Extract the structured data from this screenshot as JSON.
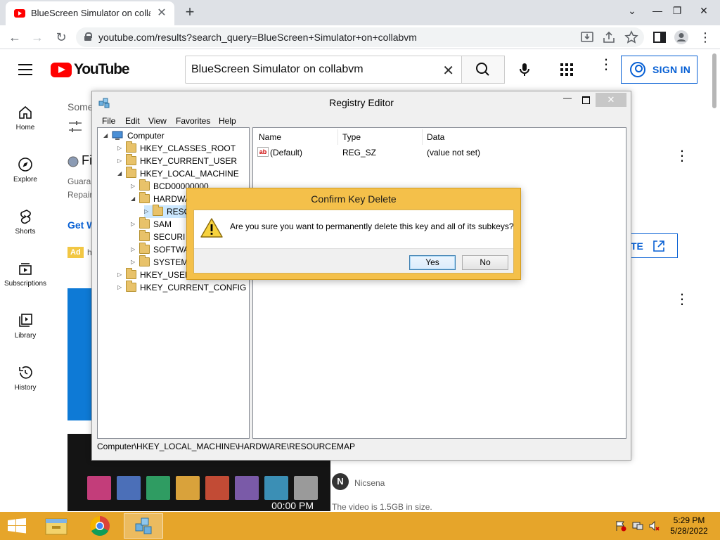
{
  "browser": {
    "tab_title": "BlueScreen Simulator on collabvm",
    "tab_close": "✕",
    "new_tab": "+",
    "url": "youtube.com/results?search_query=BlueScreen+Simulator+on+collabvm",
    "window_controls": {
      "chevron": "⌄",
      "minimize": "—",
      "maximize": "❐",
      "close": "✕"
    }
  },
  "youtube": {
    "logo_text": "YouTube",
    "search_value": "BlueScreen Simulator on collabvm",
    "search_clear": "✕",
    "signin_label": "SIGN IN",
    "sidebar": [
      {
        "label": "Home",
        "icon": "home-icon"
      },
      {
        "label": "Explore",
        "icon": "compass-icon"
      },
      {
        "label": "Shorts",
        "icon": "shorts-icon"
      },
      {
        "label": "Subscriptions",
        "icon": "subscriptions-icon"
      },
      {
        "label": "Library",
        "icon": "library-icon"
      },
      {
        "label": "History",
        "icon": "history-icon"
      }
    ],
    "bg": {
      "some": "Some",
      "fi": "Fi",
      "guara": "Guara",
      "repair": "Repair",
      "get_w": "Get W",
      "ad_badge": "Ad",
      "ad_h": "h",
      "ad_btn": "TE",
      "channel_initial": "N",
      "channel_name": "Nicsena",
      "desc": "The video is 1.5GB in size.",
      "time_fragment": "00:00 PM"
    },
    "accent_color": "#065fd4"
  },
  "regedit": {
    "title": "Registry Editor",
    "menu": [
      "File",
      "Edit",
      "View",
      "Favorites",
      "Help"
    ],
    "tree": [
      {
        "label": "Computer",
        "expander": "◢"
      },
      {
        "label": "HKEY_CLASSES_ROOT",
        "expander": "▷"
      },
      {
        "label": "HKEY_CURRENT_USER",
        "expander": "▷"
      },
      {
        "label": "HKEY_LOCAL_MACHINE",
        "expander": "◢"
      },
      {
        "label": "BCD00000000",
        "expander": "▷"
      },
      {
        "label": "HARDWA",
        "expander": "◢"
      },
      {
        "label": "RESO",
        "expander": "▷"
      },
      {
        "label": "SAM",
        "expander": "▷"
      },
      {
        "label": "SECURI",
        "expander": ""
      },
      {
        "label": "SOFTWA",
        "expander": "▷"
      },
      {
        "label": "SYSTEM",
        "expander": "▷"
      },
      {
        "label": "HKEY_USERS",
        "expander": "▷"
      },
      {
        "label": "HKEY_CURRENT_CONFIG",
        "expander": "▷"
      }
    ],
    "columns": [
      "Name",
      "Type",
      "Data"
    ],
    "rows": [
      {
        "icon_text": "ab",
        "name": "(Default)",
        "type": "REG_SZ",
        "data": "(value not set)"
      }
    ],
    "status_path": "Computer\\HKEY_LOCAL_MACHINE\\HARDWARE\\RESOURCEMAP",
    "close_glyph": "✕",
    "min_glyph": "—"
  },
  "dialog": {
    "title": "Confirm Key Delete",
    "message": "Are you sure you want to permanently delete this key and all of its subkeys?",
    "yes_label": "Yes",
    "no_label": "No",
    "frame_color": "#f4c04a"
  },
  "taskbar": {
    "time": "5:29 PM",
    "date": "5/28/2022",
    "color": "#e6a52a"
  }
}
